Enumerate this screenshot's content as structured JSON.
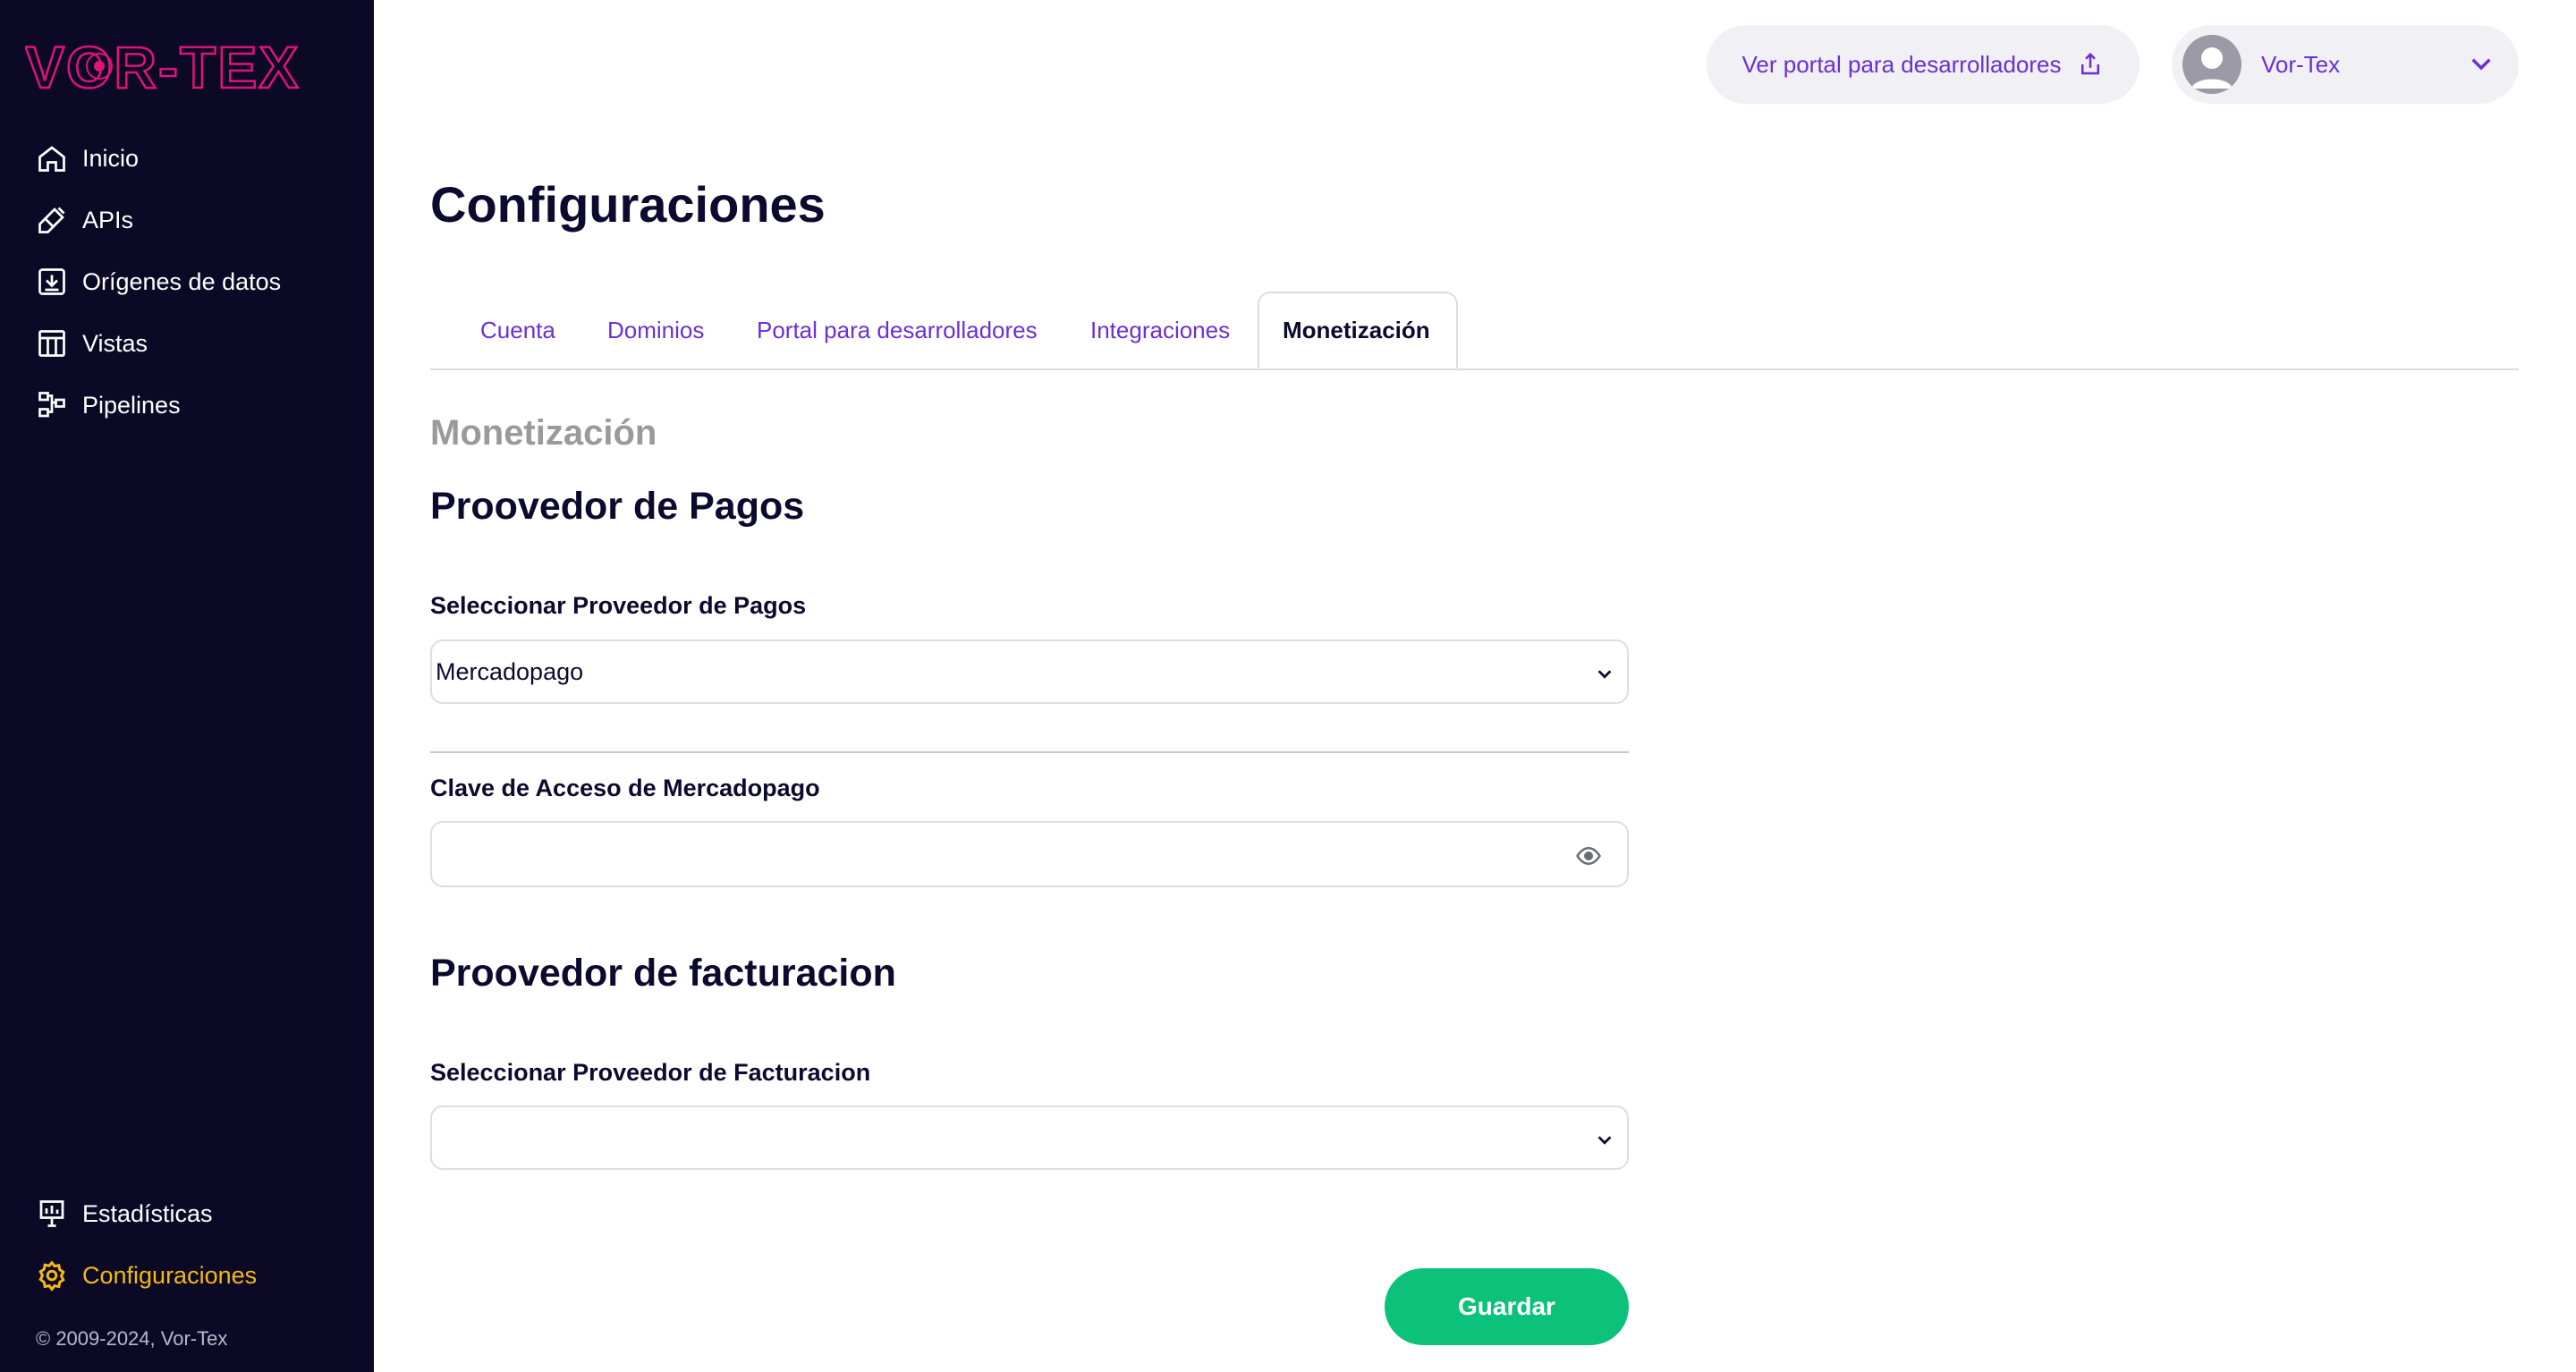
{
  "brand": {
    "logo_text": "VOR-TEX",
    "logo_color": "#e0137a"
  },
  "sidebar": {
    "items": [
      {
        "label": "Inicio",
        "icon": "home-icon"
      },
      {
        "label": "APIs",
        "icon": "plug-icon"
      },
      {
        "label": "Orígenes de datos",
        "icon": "download-icon"
      },
      {
        "label": "Vistas",
        "icon": "table-icon"
      },
      {
        "label": "Pipelines",
        "icon": "pipeline-icon"
      }
    ],
    "bottom_items": [
      {
        "label": "Estadísticas",
        "icon": "chart-icon"
      },
      {
        "label": "Configuraciones",
        "icon": "gear-icon",
        "active": true
      }
    ],
    "footer": "© 2009-2024, Vor-Tex"
  },
  "header": {
    "portal_link": "Ver portal para desarrolladores",
    "user_name": "Vor-Tex"
  },
  "page": {
    "title": "Configuraciones",
    "tabs": [
      {
        "label": "Cuenta"
      },
      {
        "label": "Dominios"
      },
      {
        "label": "Portal para desarrolladores"
      },
      {
        "label": "Integraciones"
      },
      {
        "label": "Monetización",
        "active": true
      }
    ],
    "section_label": "Monetización",
    "payments": {
      "heading": "Proovedor de Pagos",
      "select_label": "Seleccionar Proveedor de Pagos",
      "selected": "Mercadopago",
      "key_label": "Clave de Acceso de Mercadopago",
      "key_value": ""
    },
    "billing": {
      "heading": "Proovedor de facturacion",
      "select_label": "Seleccionar Proveedor de Facturacion",
      "selected": ""
    },
    "save_label": "Guardar"
  },
  "colors": {
    "sidebar_bg": "#0b0926",
    "accent_purple": "#6a2fd6",
    "active_yellow": "#f5b912",
    "save_green": "#0cc27a"
  }
}
